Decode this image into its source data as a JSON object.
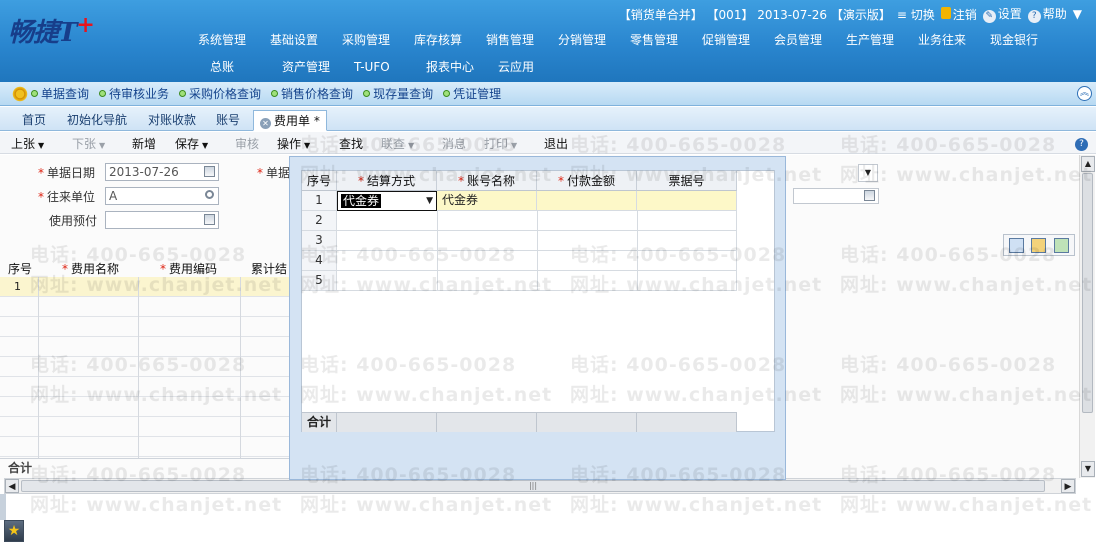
{
  "header": {
    "logo_text": "畅捷T",
    "logo_plus": "+",
    "doc_info": "【销货单合并】 【001】 2013-07-26 【演示版】",
    "switch_label": "切换",
    "logout_label": "注销",
    "settings_label": "设置",
    "help_label": "帮助",
    "menu": [
      "系统管理",
      "基础设置",
      "采购管理",
      "库存核算",
      "销售管理",
      "分销管理",
      "零售管理",
      "促销管理",
      "会员管理",
      "生产管理",
      "业务往来",
      "现金银行"
    ],
    "menu2": [
      "总账",
      "资产管理",
      "T-UFO",
      "报表中心",
      "云应用"
    ]
  },
  "quickbar": {
    "items": [
      "单据查询",
      "待审核业务",
      "采购价格查询",
      "销售价格查询",
      "现存量查询",
      "凭证管理"
    ]
  },
  "tabs": {
    "items": [
      "首页",
      "初始化导航",
      "对账收款",
      "账号"
    ],
    "active": "费用单 *"
  },
  "toolbar": {
    "prev": "上张",
    "next": "下张",
    "new": "新增",
    "save": "保存",
    "audit": "审核",
    "operate": "操作",
    "find": "查找",
    "link": "联查",
    "message": "消息",
    "print": "打印",
    "exit": "退出"
  },
  "form": {
    "date_label": "单据日期",
    "date_value": "2013-07-26",
    "partner_label": "往来单位",
    "partner_value": "A",
    "prepay_label": "使用预付",
    "doc_label_partial": "单据"
  },
  "bg_grid": {
    "headers": [
      "序号",
      "费用名称",
      "费用编码",
      "累计结"
    ],
    "row1": "1",
    "total": "合计"
  },
  "dialog": {
    "headers": {
      "no": "序号",
      "settle": "结算方式",
      "account": "账号名称",
      "amount": "付款金额",
      "ticket": "票据号"
    },
    "rows": [
      {
        "no": "1",
        "settle": "代金券",
        "account": "代金券"
      },
      {
        "no": "2"
      },
      {
        "no": "3"
      },
      {
        "no": "4"
      },
      {
        "no": "5"
      }
    ],
    "total": "合计"
  },
  "watermark": {
    "phone": "电话: 400-665-0028",
    "site": "网址: www.chanjet.net"
  },
  "colors": {
    "header_blue": "#2a86cf",
    "required_red": "#d21",
    "row_yellow": "#fdf8c8"
  }
}
